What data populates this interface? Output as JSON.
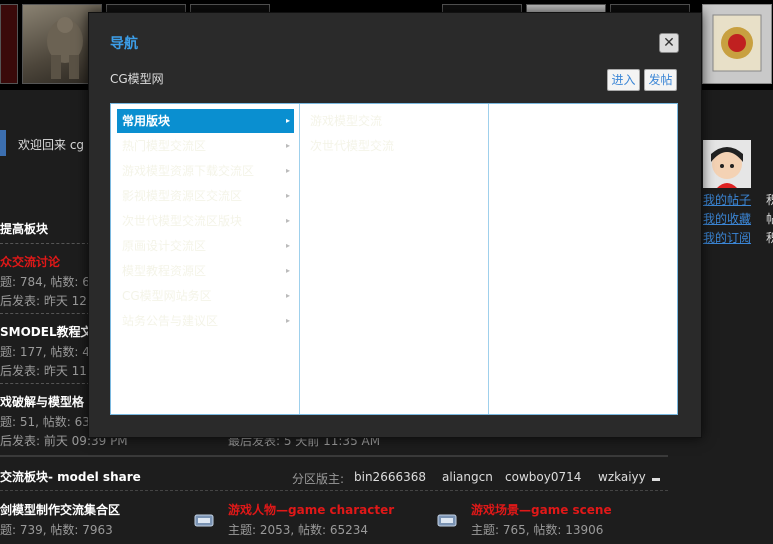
{
  "modal": {
    "title": "导航",
    "close_glyph": "✕",
    "site_name": "CG模型网",
    "enter_label": "进入",
    "post_label": "发帖",
    "categories": [
      {
        "label": "常用版块",
        "selected": true
      },
      {
        "label": "热门模型交流区",
        "selected": false
      },
      {
        "label": "游戏模型资源下载交流区",
        "selected": false
      },
      {
        "label": "影视模型资源区交流区",
        "selected": false
      },
      {
        "label": "次世代模型交流区版块",
        "selected": false
      },
      {
        "label": "原画设计交流区",
        "selected": false
      },
      {
        "label": "模型教程资源区",
        "selected": false
      },
      {
        "label": "CG模型网站务区",
        "selected": false
      },
      {
        "label": "站务公告与建议区",
        "selected": false
      }
    ],
    "subitems": [
      {
        "label": "游戏模型交流"
      },
      {
        "label": "次世代模型交流"
      }
    ],
    "chevron_glyph": "▸"
  },
  "background": {
    "welcome": "欢迎回来 cg",
    "section1_title": "提高板块",
    "forums": [
      {
        "name": "众交流讨论",
        "stats": "题: 784, 帖数: 6",
        "last": "后发表: 昨天 12:"
      },
      {
        "name": "SMODEL教程文",
        "stats": "题: 177, 帖数: 4",
        "last": "后发表: 昨天 11:"
      },
      {
        "name": "戏破解与模型格",
        "stats": "题: 51, 帖数: 63",
        "last": "后发表: 前天 09:39 PM"
      }
    ],
    "last_post_2": "最后发表: 5 天前 11:35 AM",
    "section2_title": "交流板块-   model share",
    "moderators_label": "分区版主:",
    "moderators": [
      "bin2666368",
      "aliangcn",
      "cowboy0714",
      "wzkaiyy"
    ],
    "row2": [
      {
        "name": "剑模型制作交流集合区",
        "stats": "题: 739, 帖数: 7963"
      },
      {
        "name": "游戏人物—game character",
        "stats": "主题: 2053, 帖数: 65234"
      },
      {
        "name": "游戏场景—game scene",
        "stats": "主题: 765, 帖数: 13906"
      }
    ],
    "user_links": [
      "我的帖子",
      "我的收藏",
      "我的订阅"
    ],
    "right_fragments": [
      "积",
      "帖",
      "积"
    ]
  }
}
